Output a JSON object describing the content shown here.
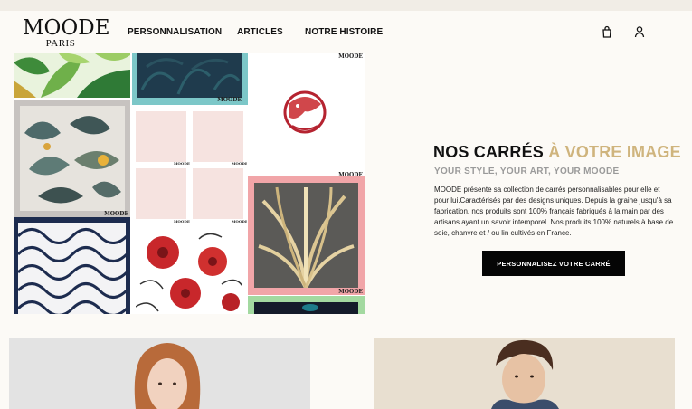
{
  "brand": {
    "name": "MOODE",
    "city": "PARIS"
  },
  "nav": {
    "items": [
      "PERSONNALISATION",
      "ARTICLES",
      "NOTRE HISTOIRE"
    ]
  },
  "header_icons": [
    "shopping-bag-icon",
    "user-icon"
  ],
  "collage": {
    "tile_mark": "MOODE",
    "colors": {
      "teal": "#7cc7c8",
      "navy": "#1d2c4f",
      "pink_border": "#f1a5a8",
      "green_border": "#a3d9a0",
      "red": "#c8272b"
    }
  },
  "hero": {
    "title_black": "NOS CARRÉS",
    "title_gold": "À VOTRE IMAGE",
    "subtitle": "YOUR STYLE, YOUR ART, YOUR MOODE",
    "description": "MOODE présente sa collection de carrés personnalisables pour elle et pour lui.Caractérisés par des designs uniques. Depuis la graine jusqu'à sa fabrication, nos produits sont 100% français fabriqués à la main par des artisans ayant un savoir intemporel. Nos produits 100% naturels à base de soie, chanvre et / ou lin cultivés en France.",
    "cta_label": "PERSONNALISEZ VOTRE CARRÉ",
    "accent_color": "#cfb47d"
  }
}
